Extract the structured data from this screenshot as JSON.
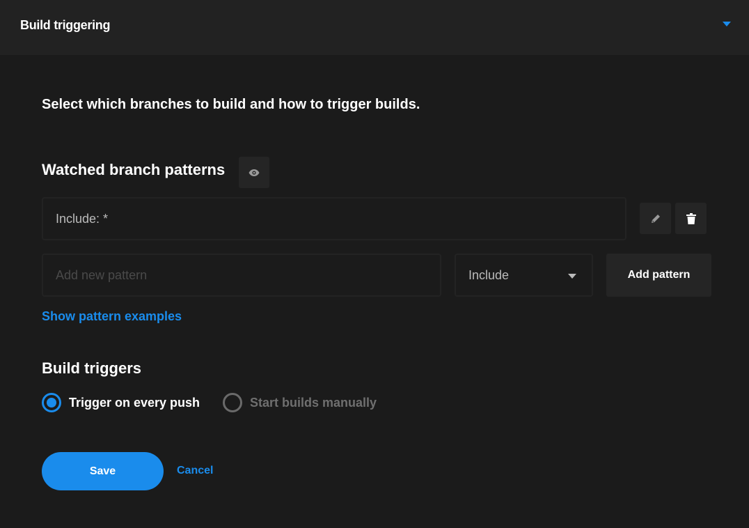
{
  "header": {
    "title": "Build triggering",
    "caret_icon": "caret-down-icon",
    "accent": "#1a8cec"
  },
  "description": "Select which branches to build and how to trigger builds.",
  "watched": {
    "title": "Watched branch patterns",
    "eye_icon": "eye-icon",
    "patterns": [
      {
        "text": "Include: *"
      }
    ],
    "new_pattern_placeholder": "Add new pattern",
    "new_pattern_value": "",
    "type_select": "Include",
    "add_label": "Add pattern",
    "examples_link": "Show pattern examples"
  },
  "triggers": {
    "title": "Build triggers",
    "options": [
      {
        "label": "Trigger on every push",
        "selected": true
      },
      {
        "label": "Start builds manually",
        "selected": false
      }
    ]
  },
  "actions": {
    "save": "Save",
    "cancel": "Cancel"
  }
}
